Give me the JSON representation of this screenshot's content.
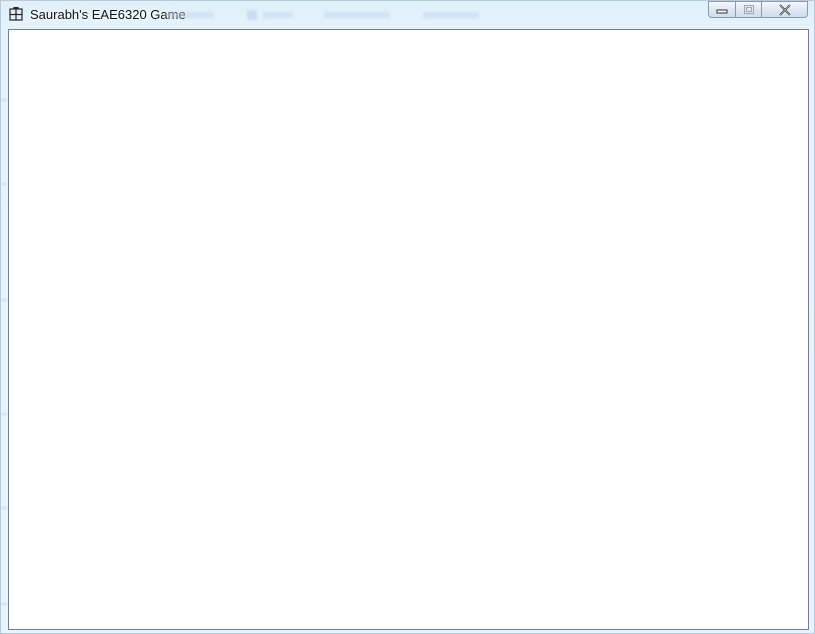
{
  "window": {
    "title": "Saurabh's EAE6320 Game",
    "app_icon": "game-grid-icon",
    "caption_buttons": {
      "minimize_icon": "minimize-icon",
      "maximize_icon": "maximize-icon",
      "close_icon": "close-icon"
    }
  },
  "client_area": {
    "background": "#ffffff"
  },
  "colors": {
    "frame": "#e4f2fc",
    "client_border": "#6f7f93",
    "caption_border": "#8a99ab"
  }
}
